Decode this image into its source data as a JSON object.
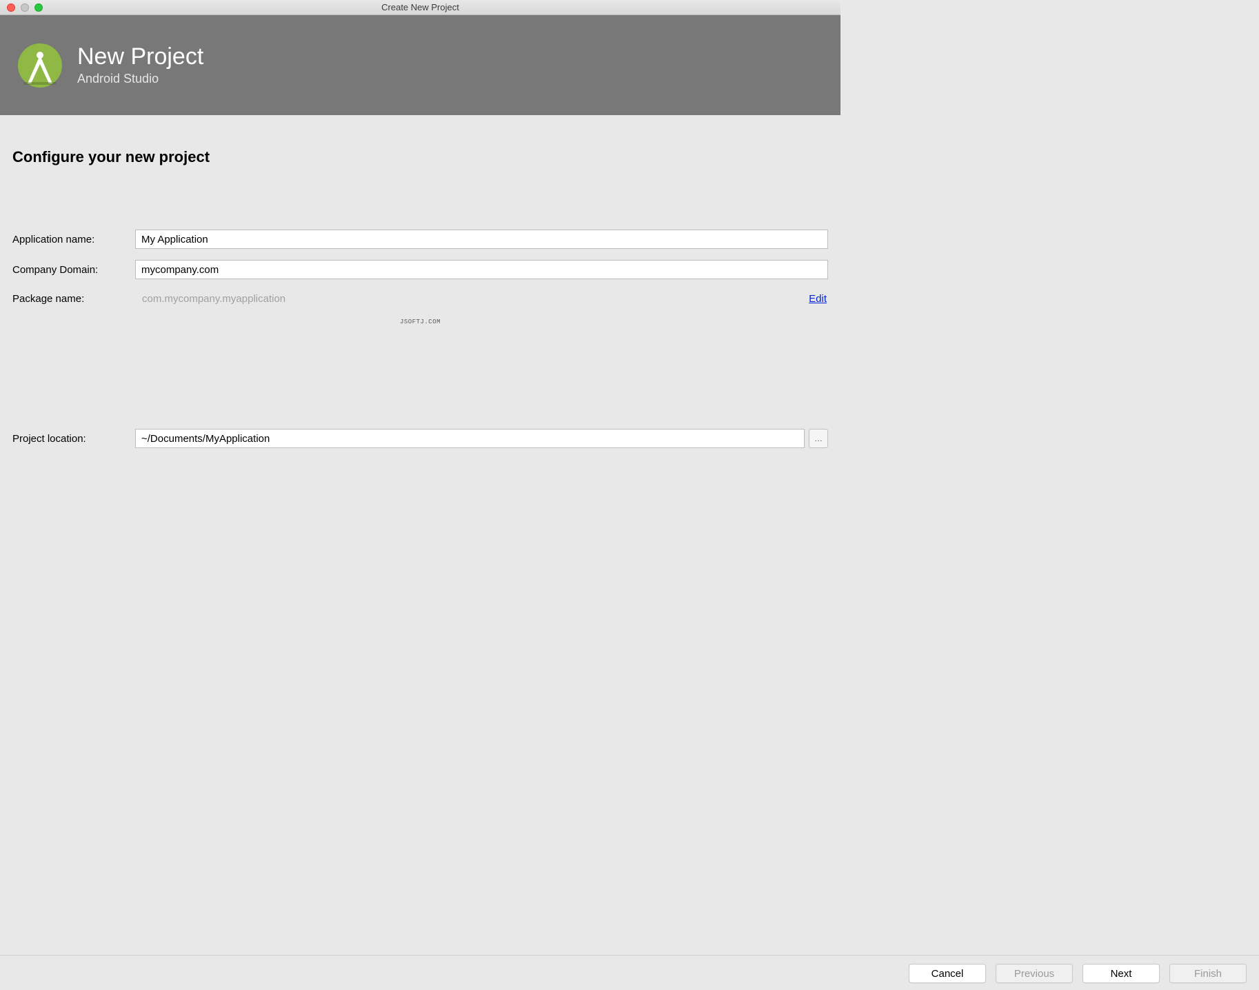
{
  "window": {
    "title": "Create New Project"
  },
  "banner": {
    "title": "New Project",
    "subtitle": "Android Studio"
  },
  "section": {
    "heading": "Configure your new project"
  },
  "form": {
    "appNameLabel": "Application name:",
    "appNameValue": "My Application",
    "companyDomainLabel": "Company Domain:",
    "companyDomainValue": "mycompany.com",
    "packageNameLabel": "Package name:",
    "packageNameValue": "com.mycompany.myapplication",
    "editLink": "Edit",
    "projectLocationLabel": "Project location:",
    "projectLocationValue": "~/Documents/MyApplication",
    "browseLabel": "…"
  },
  "watermark": "JSOFTJ.COM",
  "footer": {
    "cancel": "Cancel",
    "previous": "Previous",
    "next": "Next",
    "finish": "Finish"
  }
}
